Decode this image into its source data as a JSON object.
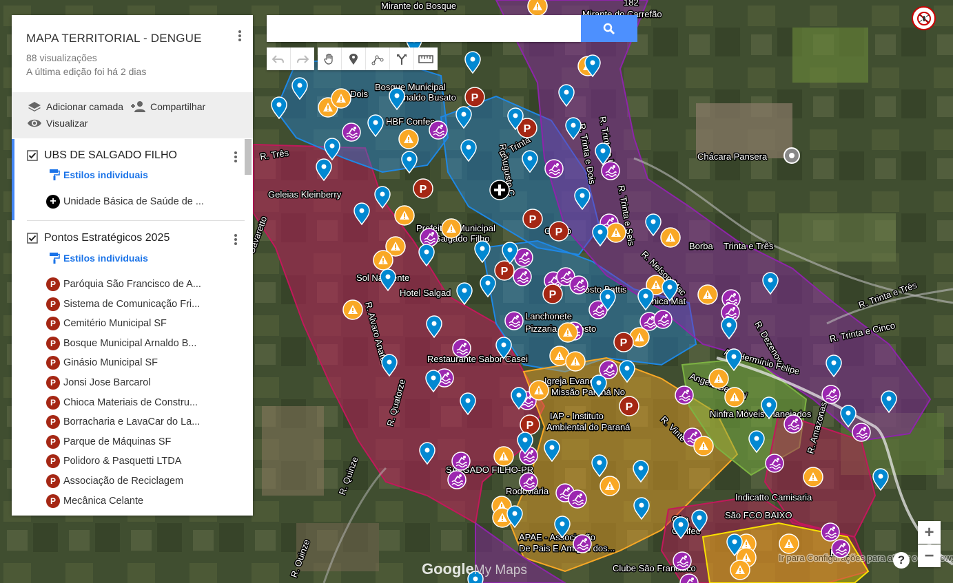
{
  "panel": {
    "title": "MAPA TERRITORIAL - DENGUE",
    "views": "88 visualizações",
    "edited": "A última edição foi há 2 dias",
    "actions": {
      "add_layer": "Adicionar camada",
      "share": "Compartilhar",
      "preview": "Visualizar"
    },
    "layers": [
      {
        "name": "UBS DE SALGADO FILHO",
        "styles": "Estilos individuais",
        "items": [
          "Unidade Básica de Saúde de ..."
        ]
      },
      {
        "name": "Pontos Estratégicos 2025",
        "styles": "Estilos individuais",
        "items": [
          "Paróquia São Francisco de A...",
          "Sistema de Comunicação Fri...",
          "Cemitério Municipal SF",
          "Bosque Municipal Arnaldo B...",
          "Ginásio Municipal SF",
          "Jonsi Jose Barcarol",
          "Chioca Materiais de Constru...",
          "Borracharia e LavaCar do La...",
          "Parque de Máquinas SF",
          "Polidoro & Pasquetti LTDA",
          "Associação de Reciclagem",
          "Mecânica Celante"
        ]
      }
    ]
  },
  "search": {
    "value": ""
  },
  "toolbar": [
    "undo-icon",
    "redo-icon",
    "hand-icon",
    "marker-icon",
    "line-icon",
    "directions-icon",
    "ruler-icon"
  ],
  "map": {
    "logo_google": "Google",
    "logo_mymaps": "My Maps",
    "labels": [
      "Mirante do Bosque",
      "Mirante do Carrefão",
      "182",
      "Bosque Municipal",
      "Arnaldo Busato",
      "Dois",
      "HBF Confec",
      "R. Três",
      "Geleias Kleinberry",
      "R. Augusto C",
      "R. Trinta",
      "R. Trinta e Dois",
      "R. Trinta e Um",
      "R. Trinta e Seis",
      "Chácara Pansera",
      "Prefeitura Municipal",
      "de Salgado Filho",
      "Centro",
      "Borba",
      "Trinta e Três",
      "R. Nelson Mac",
      "Sol Nascente",
      "Hotel Salgad",
      "R. Alvaro Anater",
      "Posto Battis",
      "Lanchonete",
      "Pizzaria",
      "Posto",
      "nica Mat",
      "R. Trinta e Três",
      "R. Trinta e Cinco",
      "R. Dezenove",
      "Av. Hermínio Felipe",
      "Restaurante Sabor Casei",
      "Igreja Evang",
      "Missão Paraná No",
      "Angelo Bestani",
      "Ninfra Móveis Planejados",
      "R. Quatorze",
      "IAP - Instituto",
      "Ambiental do Paraná",
      "R. Vinte",
      "R. Amazonas",
      "SALGADO FILHO-PR",
      "Rodoviária",
      "R. Quinze",
      "Indicatto Camisaria",
      "São FCO BAIXO",
      "Gira",
      "Confec",
      "APAE - Associação",
      "De Pais E Amigos dos...",
      "Clube São Francisco",
      "R. Ouinze",
      "R. N",
      "Gavaretto",
      "Ir para Configurações para ativar o Windows."
    ]
  },
  "colors": {
    "zone_red": "#c2185b",
    "zone_blue": "#1e88e5",
    "zone_purple": "#8e24aa",
    "zone_yellow": "#f9a825",
    "zone_green": "#7cb342",
    "pin_blue": "#0288d1",
    "pin_orange": "#f9a825",
    "pin_purple": "#9c27b0",
    "pin_red": "#a52714"
  }
}
